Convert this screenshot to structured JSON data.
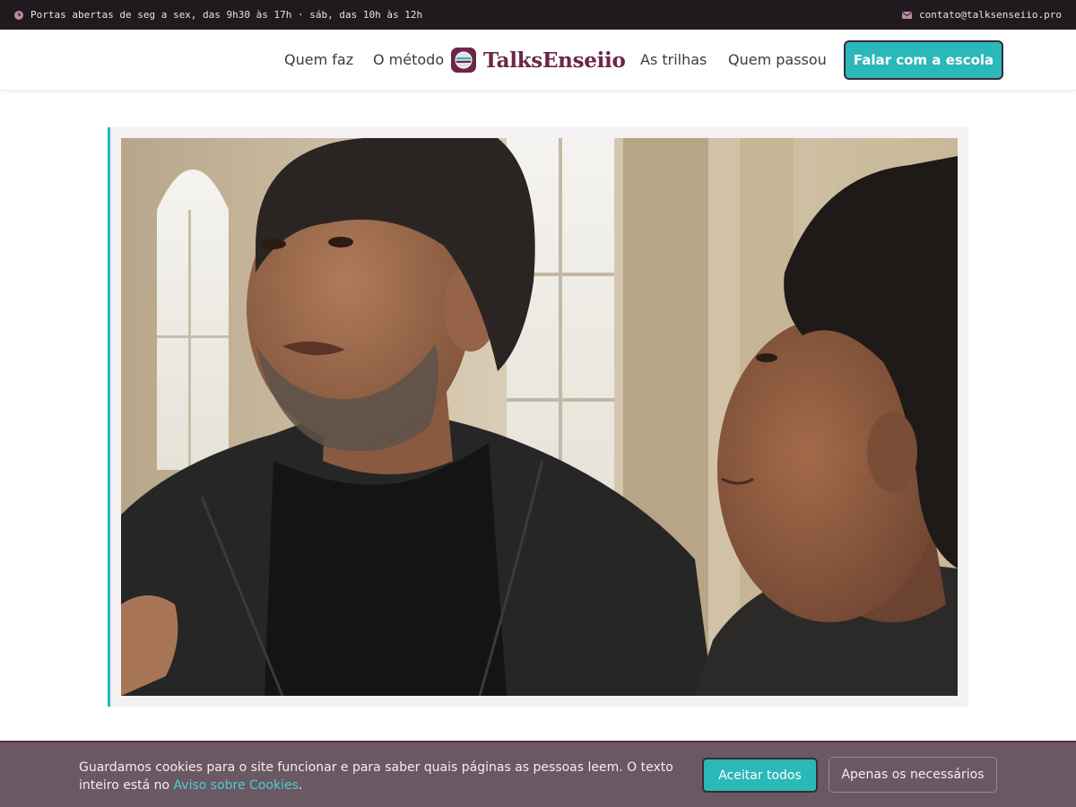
{
  "topbar": {
    "hours_icon": "clock-icon",
    "hours": "Portas abertas de seg a sex, das 9h30 às 17h · sáb, das 10h às 12h",
    "email_icon": "envelope-icon",
    "email": "contato@talksenseiio.pro"
  },
  "header": {
    "nav_left": [
      "Quem faz",
      "O método"
    ],
    "logo_icon": "brand-logo-icon",
    "logo_text": "TalksEnseiio",
    "nav_right": [
      "As trilhas",
      "Quem passou"
    ],
    "cta_label": "Falar com a escola"
  },
  "hero": {
    "image_description_icon": "photo-two-people-talking"
  },
  "cookie_banner": {
    "text_before": "Guardamos cookies para o site funcionar e para saber quais páginas as pessoas leem. O texto inteiro está no ",
    "link_text": "Aviso sobre Cookies",
    "text_after": ".",
    "accept_label": "Aceitar todos",
    "necessary_label": "Apenas os necessários"
  },
  "colors": {
    "accent": "#2ab8b9",
    "brand": "#6b2748",
    "topbar_bg": "#201a1e",
    "cookie_bg": "#6a5862"
  }
}
